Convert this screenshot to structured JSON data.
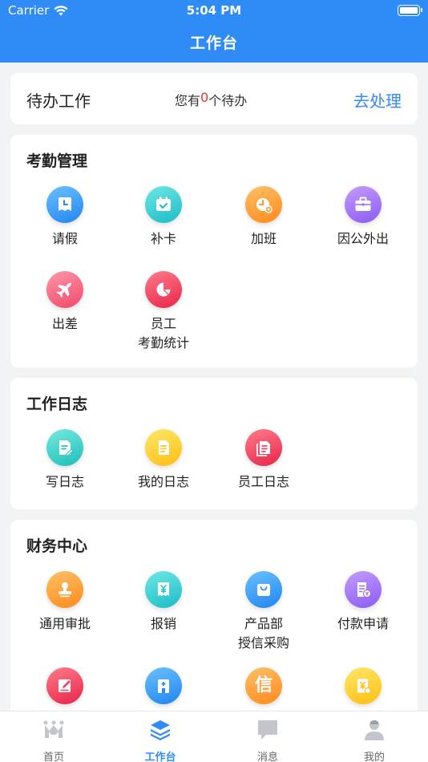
{
  "status_bar": {
    "carrier": "Carrier",
    "time": "5:04 PM"
  },
  "nav": {
    "title": "工作台"
  },
  "todo": {
    "title": "待办工作",
    "msg_prefix": "您有",
    "count": "0",
    "msg_suffix": "个待办",
    "action": "去处理"
  },
  "attendance": {
    "title": "考勤管理",
    "items": [
      {
        "label": "请假",
        "icon": "leave-icon"
      },
      {
        "label": "补卡",
        "icon": "calendar-check-icon"
      },
      {
        "label": "加班",
        "icon": "overtime-clock-icon"
      },
      {
        "label": "因公外出",
        "icon": "briefcase-icon"
      },
      {
        "label": "出差",
        "icon": "airplane-icon"
      },
      {
        "label_line1": "员工",
        "label_line2": "考勤统计",
        "icon": "pie-chart-icon"
      }
    ]
  },
  "worklog": {
    "title": "工作日志",
    "items": [
      {
        "label": "写日志",
        "icon": "write-log-icon"
      },
      {
        "label": "我的日志",
        "icon": "my-log-icon"
      },
      {
        "label": "员工日志",
        "icon": "staff-log-icon"
      }
    ]
  },
  "finance": {
    "title": "财务中心",
    "items": [
      {
        "label": "通用审批",
        "icon": "stamp-icon"
      },
      {
        "label": "报销",
        "icon": "receipt-yen-icon"
      },
      {
        "label_line1": "产品部",
        "label_line2": "授信采购",
        "icon": "shopping-bag-icon"
      },
      {
        "label": "付款申请",
        "icon": "payment-doc-icon"
      },
      {
        "icon": "edit-note-icon"
      },
      {
        "icon": "hospital-icon"
      },
      {
        "glyph": "信",
        "icon": "credit-icon"
      },
      {
        "icon": "yen-card-icon"
      }
    ]
  },
  "tabbar": {
    "tabs": [
      {
        "label": "首页",
        "icon": "home-logo-icon"
      },
      {
        "label": "工作台",
        "icon": "layers-icon",
        "active": true
      },
      {
        "label": "消息",
        "icon": "message-icon"
      },
      {
        "label": "我的",
        "icon": "profile-icon"
      }
    ]
  },
  "colors": {
    "primary": "#2f8cf7",
    "alert": "#e8372c",
    "background": "#f2f3f5"
  }
}
